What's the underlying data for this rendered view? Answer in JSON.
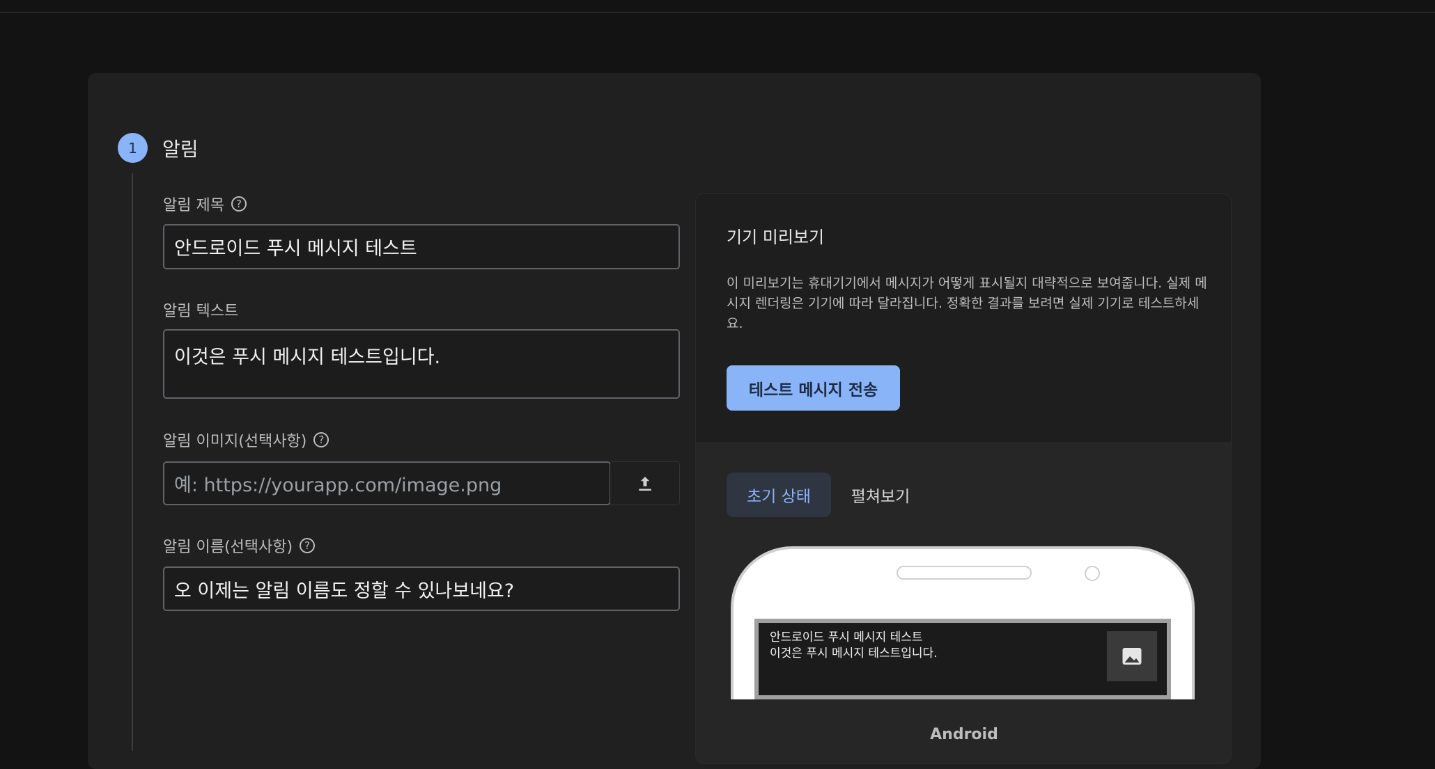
{
  "step": {
    "number": "1",
    "title": "알림"
  },
  "form": {
    "title_label": "알림 제목",
    "title_value": "안드로이드 푸시 메시지 테스트",
    "text_label": "알림 텍스트",
    "text_value": "이것은 푸시 메시지 테스트입니다.",
    "image_label": "알림 이미지(선택사항)",
    "image_placeholder": "예: https://yourapp.com/image.png",
    "name_label": "알림 이름(선택사항)",
    "name_value": "오 이제는 알림 이름도 정할 수 있나보네요?",
    "help_glyph": "?"
  },
  "preview": {
    "title": "기기 미리보기",
    "description": "이 미리보기는 휴대기기에서 메시지가 어떻게 표시될지 대략적으로 보여줍니다. 실제 메시지 렌더링은 기기에 따라 달라집니다. 정확한 결과를 보려면 실제 기기로 테스트하세요.",
    "send_button": "테스트 메시지 전송",
    "tabs": [
      {
        "label": "초기 상태",
        "active": true
      },
      {
        "label": "펼쳐보기",
        "active": false
      }
    ],
    "notification": {
      "title": "안드로이드 푸시 메시지 테스트",
      "body": "이것은 푸시 메시지 테스트입니다."
    },
    "platform": "Android"
  },
  "icons": {
    "help": "help-circle-icon",
    "upload": "upload-icon",
    "image": "image-icon"
  },
  "colors": {
    "accent": "#8ab4f8",
    "background": "#131313",
    "card": "#202020"
  }
}
